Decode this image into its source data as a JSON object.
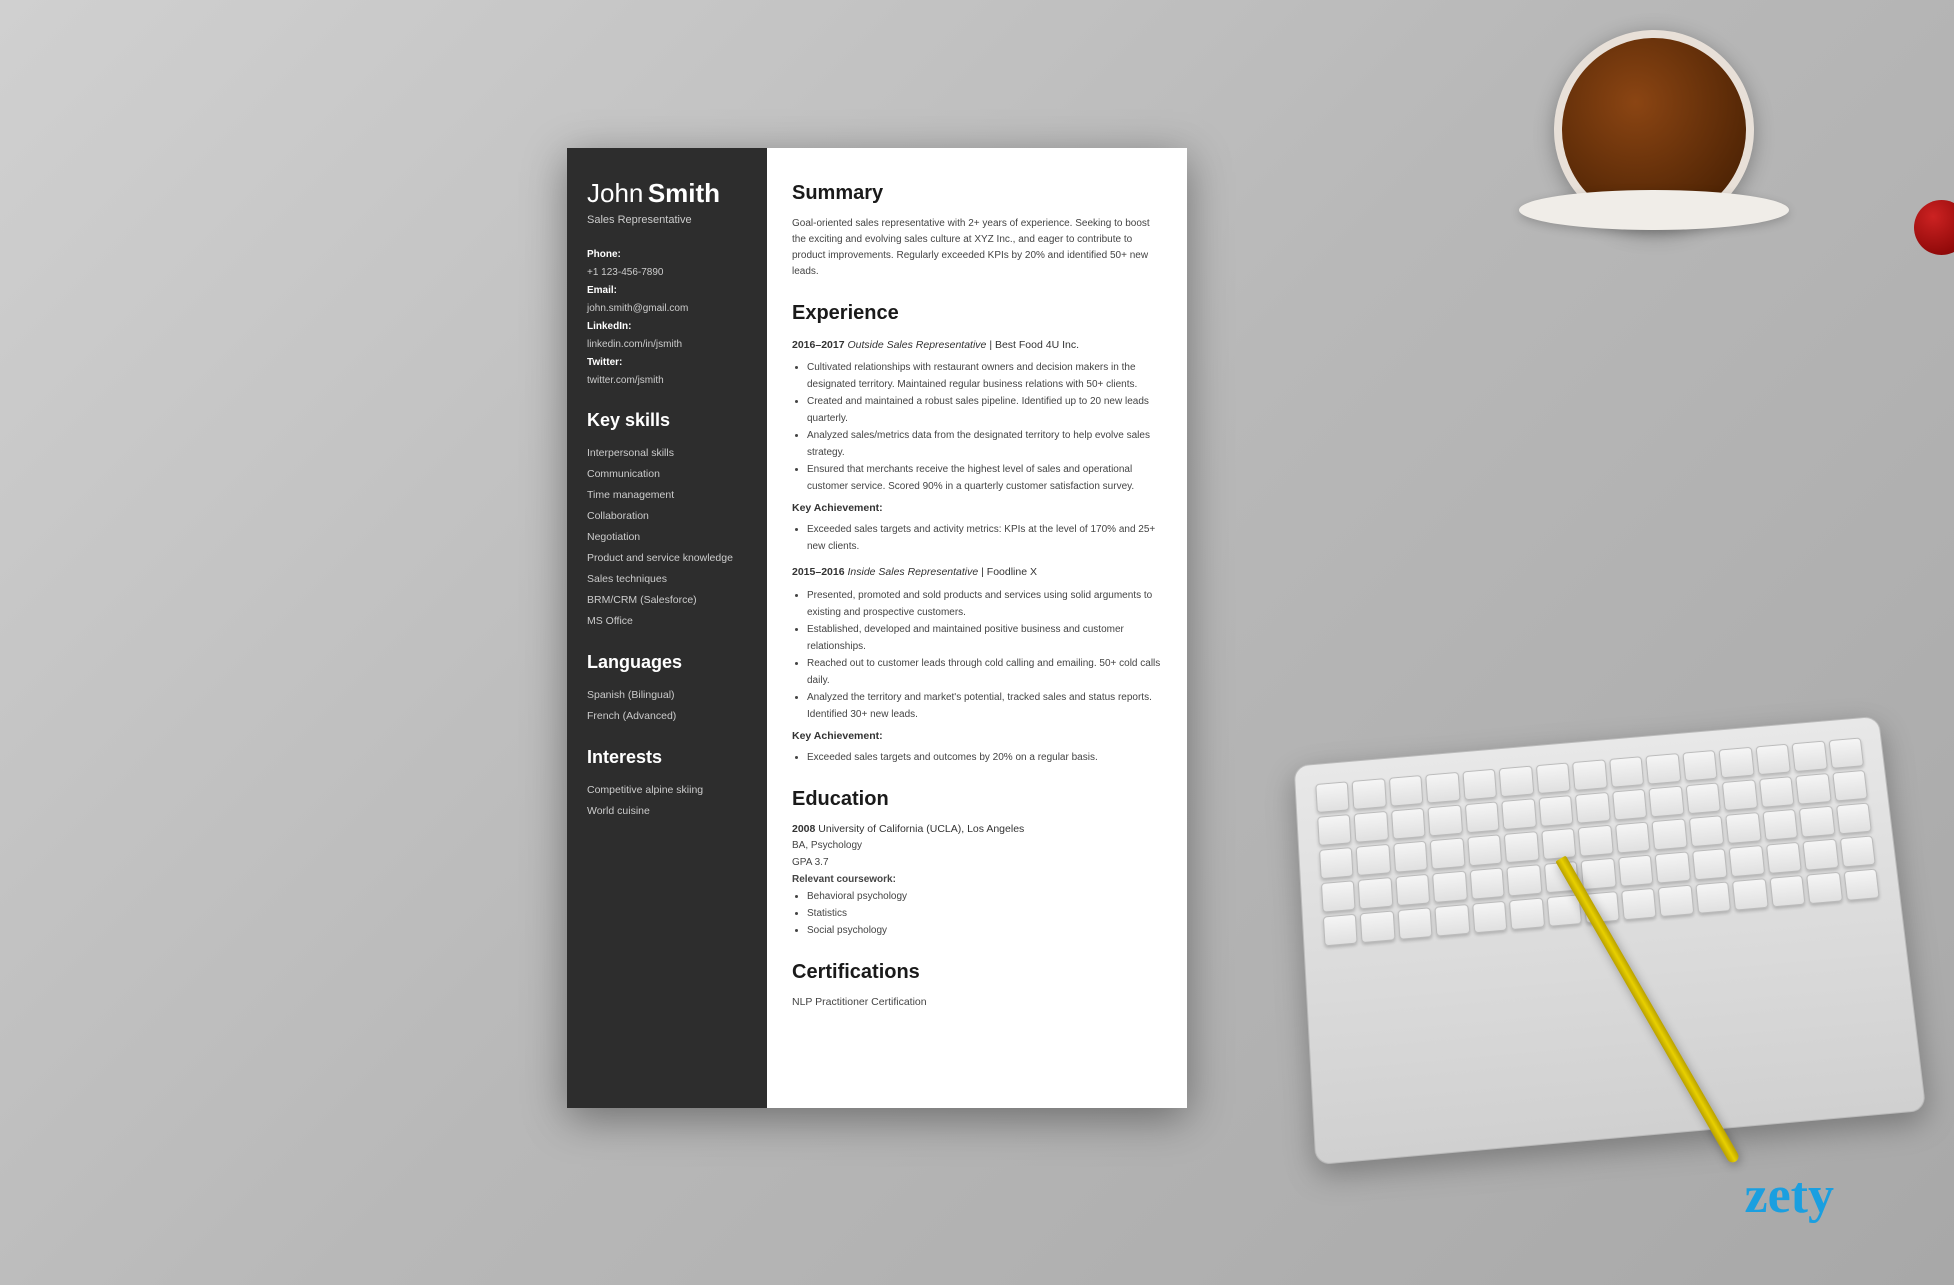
{
  "page": {
    "background_color": "#b8b8b8"
  },
  "branding": {
    "logo": "zety",
    "logo_color": "#1a9fe0"
  },
  "resume": {
    "sidebar": {
      "first_name": "John",
      "last_name": "Smith",
      "title": "Sales Representative",
      "contact": {
        "phone_label": "Phone:",
        "phone": "+1 123-456-7890",
        "email_label": "Email:",
        "email": "john.smith@gmail.com",
        "linkedin_label": "LinkedIn:",
        "linkedin": "linkedin.com/in/jsmith",
        "twitter_label": "Twitter:",
        "twitter": "twitter.com/jsmith"
      },
      "skills_title": "Key skills",
      "skills": [
        "Interpersonal skills",
        "Communication",
        "Time management",
        "Collaboration",
        "Negotiation",
        "Product and service knowledge",
        "Sales techniques",
        "BRM/CRM (Salesforce)",
        "MS Office"
      ],
      "languages_title": "Languages",
      "languages": [
        "Spanish (Bilingual)",
        "French (Advanced)"
      ],
      "interests_title": "Interests",
      "interests": [
        "Competitive alpine skiing",
        "World cuisine"
      ]
    },
    "main": {
      "summary_title": "Summary",
      "summary_text": "Goal-oriented sales representative with 2+ years of experience. Seeking to boost the exciting and evolving sales culture at XYZ Inc., and eager to contribute to product improvements. Regularly exceeded KPIs by 20% and identified 50+ new leads.",
      "experience_title": "Experience",
      "jobs": [
        {
          "years": "2016–2017",
          "title": "Outside Sales Representative",
          "company": "Best Food 4U Inc.",
          "bullets": [
            "Cultivated relationships with restaurant owners and decision makers in the designated territory. Maintained regular business relations with 50+ clients.",
            "Created and maintained a robust sales pipeline. Identified up to 20 new leads quarterly.",
            "Analyzed sales/metrics data from the designated territory to help evolve sales strategy.",
            "Ensured that merchants receive the highest level of sales and operational customer service. Scored 90% in a quarterly customer satisfaction survey."
          ],
          "achievement_label": "Key Achievement:",
          "achievement": "Exceeded sales targets and activity metrics: KPIs at the level of 170% and 25+ new clients."
        },
        {
          "years": "2015–2016",
          "title": "Inside Sales Representative",
          "company": "Foodline X",
          "bullets": [
            "Presented, promoted and sold products and services using solid arguments to existing and prospective customers.",
            "Established, developed and maintained positive business and customer relationships.",
            "Reached out to customer leads through cold calling and emailing. 50+ cold calls daily.",
            "Analyzed the territory and market's potential, tracked sales and status reports. Identified 30+ new leads."
          ],
          "achievement_label": "Key Achievement:",
          "achievement": "Exceeded sales targets and outcomes by 20% on a regular basis."
        }
      ],
      "education_title": "Education",
      "education": {
        "year": "2008",
        "school": "University of California (UCLA), Los Angeles",
        "degree": "BA, Psychology",
        "gpa": "GPA 3.7",
        "coursework_label": "Relevant coursework:",
        "coursework": [
          "Behavioral psychology",
          "Statistics",
          "Social psychology"
        ]
      },
      "certifications_title": "Certifications",
      "certifications": [
        "NLP Practitioner Certification"
      ]
    }
  }
}
